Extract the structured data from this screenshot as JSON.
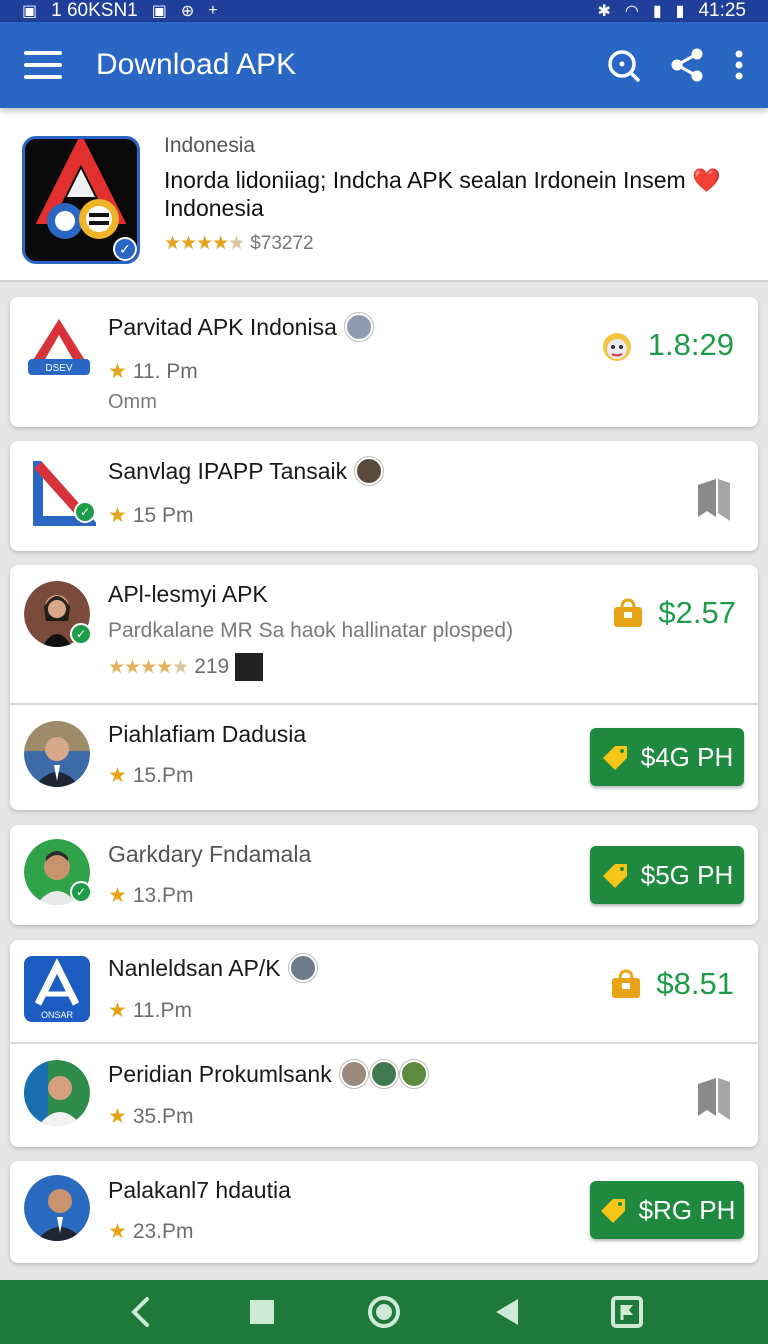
{
  "status_bar": {
    "left_text": "1 60KSN1",
    "time": "41:25"
  },
  "app_bar": {
    "title": "Download APK"
  },
  "header": {
    "country": "Indonesia",
    "title": "Inorda lidoniiag; Indcha APK sealan Irdonein Insem ❤️ Indonesia",
    "rating_text": "$73272"
  },
  "items": [
    {
      "name": "Parvitad APK Indonisa",
      "rating": "11. Pm",
      "sub": "Omm",
      "price": "1.8:29"
    },
    {
      "name": "Sanvlag IPAPP Tansaik",
      "rating": "15 Pm"
    },
    {
      "name": "APl-lesmyi APK",
      "description": "Pardkalane MR Sa haok hallinatar plosped)",
      "rating": "219",
      "price": "$2.57"
    },
    {
      "name": "Piahlafiam Dadusia",
      "rating": "15.Pm",
      "button": "$4G PH"
    },
    {
      "name": "Garkdary Fndamala",
      "rating": "13.Pm",
      "button": "$5G PH"
    },
    {
      "name": "Nanleldsan AP/K",
      "rating": "11.Pm",
      "price": "$8.51"
    },
    {
      "name": "Peridian Prokumlsank",
      "rating": "35.Pm"
    },
    {
      "name": "Palakanl7 hdautia",
      "rating": "23.Pm",
      "button": "$RG PH"
    }
  ],
  "icon_labels": {
    "dsev": "DSEV",
    "onsar": "ONSAR",
    "blue_a": "ONSAR"
  },
  "colors": {
    "appbar": "#2a67c4",
    "statusbar": "#1f3f9a",
    "price": "#1f9c4a",
    "button": "#1f8a3f",
    "navbar": "#1e7a3a",
    "star": "#e2a31a"
  }
}
